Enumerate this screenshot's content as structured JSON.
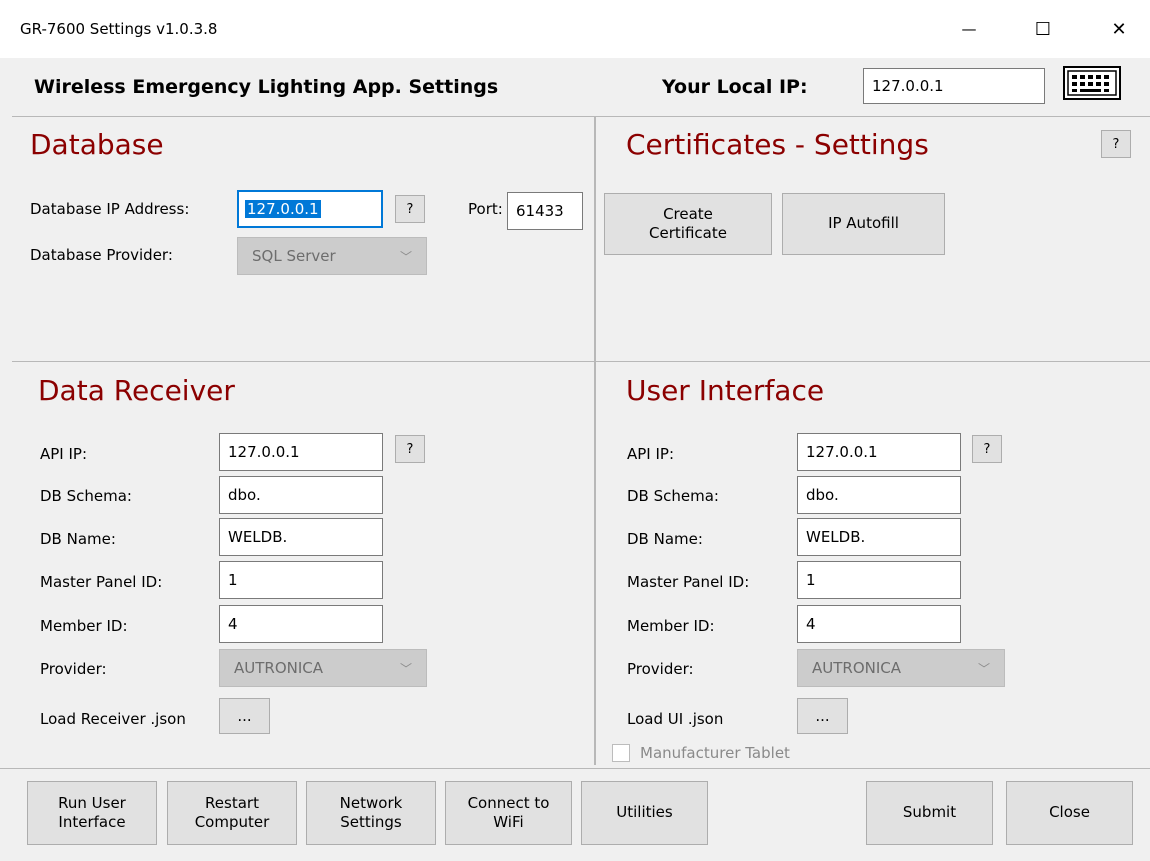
{
  "window": {
    "title": "GR-7600 Settings v1.0.3.8",
    "minimize": "—",
    "maximize": "☐",
    "close": "✕"
  },
  "header": {
    "app_title": "Wireless Emergency Lighting App. Settings",
    "local_ip_label": "Your Local IP:",
    "local_ip_value": "127.0.0.1",
    "keyboard_icon": "keyboard-icon"
  },
  "database": {
    "title": "Database",
    "ip_label": "Database IP Address:",
    "ip_value": "127.0.0.1",
    "help": "?",
    "port_label": "Port:",
    "port_value": "61433",
    "provider_label": "Database Provider:",
    "provider_value": "SQL Server"
  },
  "certificates": {
    "title": "Certificates - Settings",
    "help": "?",
    "create_button": "Create\nCertificate",
    "autofill_button": "IP Autofill"
  },
  "data_receiver": {
    "title": "Data Receiver",
    "api_ip_label": "API IP:",
    "api_ip_value": "127.0.0.1",
    "help": "?",
    "schema_label": "DB Schema:",
    "schema_value": "dbo.",
    "dbname_label": "DB Name:",
    "dbname_value": "WELDB.",
    "master_label": "Master Panel ID:",
    "master_value": "1",
    "member_label": "Member ID:",
    "member_value": "4",
    "provider_label": "Provider:",
    "provider_value": "AUTRONICA",
    "load_label": "Load Receiver .json",
    "load_button": "..."
  },
  "user_interface": {
    "title": "User Interface",
    "api_ip_label": "API  IP:",
    "api_ip_value": "127.0.0.1",
    "help": "?",
    "schema_label": "DB Schema:",
    "schema_value": "dbo.",
    "dbname_label": "DB Name:",
    "dbname_value": "WELDB.",
    "master_label": "Master Panel ID:",
    "master_value": "1",
    "member_label": "Member ID:",
    "member_value": "4",
    "provider_label": "Provider:",
    "provider_value": "AUTRONICA",
    "load_label": "Load UI .json",
    "load_button": "...",
    "manufacturer_label": "Manufacturer Tablet"
  },
  "footer": {
    "run_ui": "Run User\nInterface",
    "restart": "Restart\nComputer",
    "network": "Network\nSettings",
    "wifi": "Connect to\nWiFi",
    "utilities": "Utilities",
    "submit": "Submit",
    "close": "Close"
  }
}
